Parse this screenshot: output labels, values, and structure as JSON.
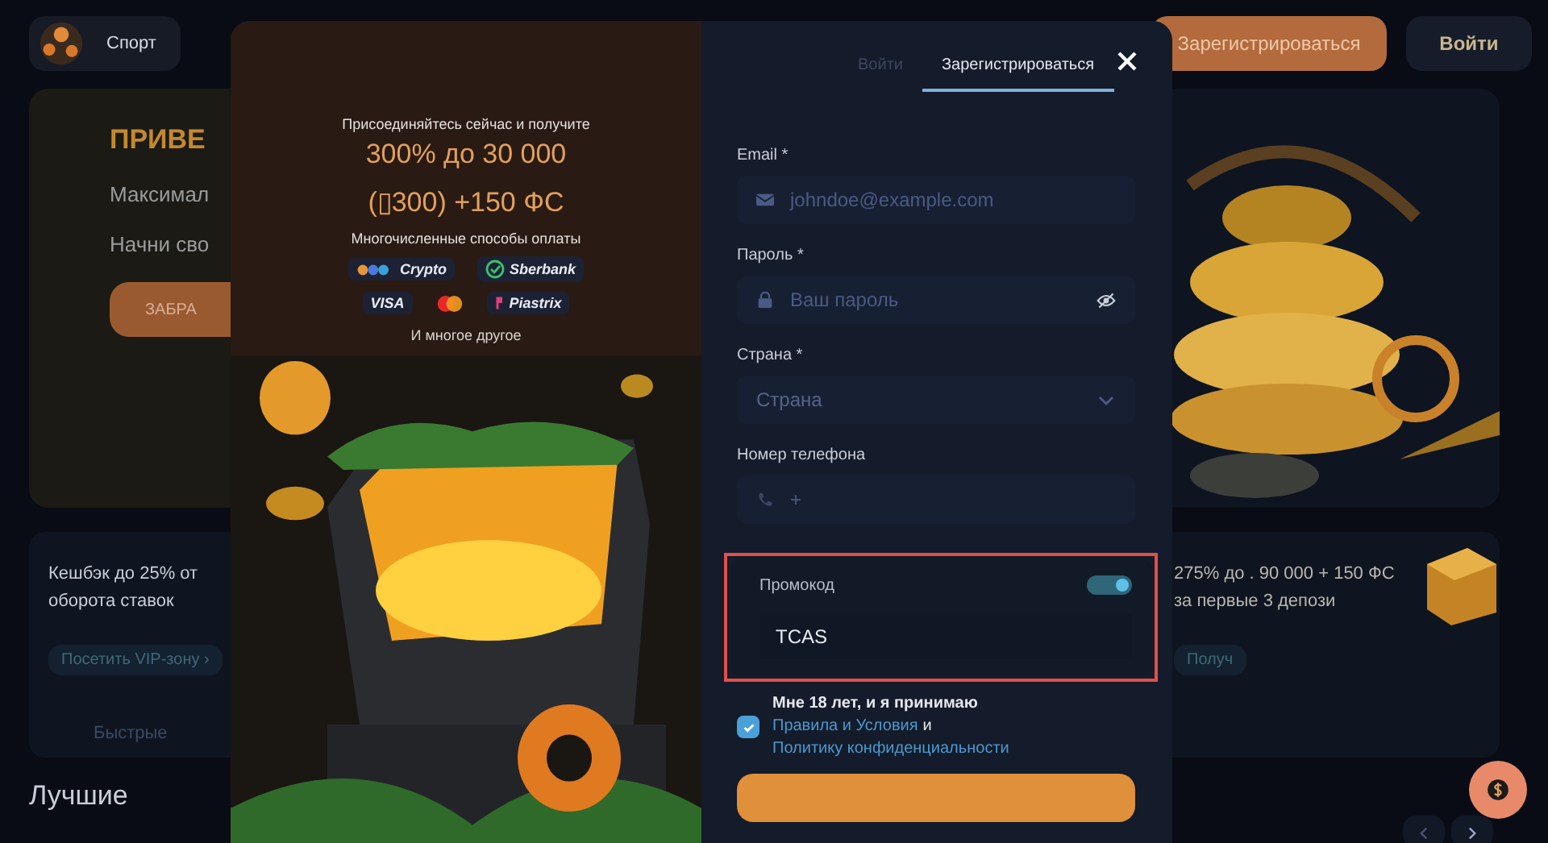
{
  "header": {
    "sport_label": "Спорт",
    "register_button": "Зарегистрироваться",
    "login_button": "Войти"
  },
  "hero": {
    "title": "ПРИВЕ",
    "line_1": "Максимал",
    "line_2": "Начни сво",
    "button": "ЗАБРА"
  },
  "cards": [
    {
      "text": "Кешбэк до 25% от оборота ставок",
      "link": "Посетить VIP-зону ›"
    },
    {
      "text": "275% до . 90 000 + 150 ФС за первые 3 депози",
      "link": "Получ"
    }
  ],
  "quick_row": "Быстрые",
  "section_title": "Лучшие",
  "modal": {
    "promo": {
      "intro": "Присоединяйтесь сейчас и получите",
      "bonus_line_1": "300% до 30 000",
      "bonus_line_2": "(▯300) +150 ФС",
      "payments_title": "Многочисленные способы оплаты",
      "payments": [
        {
          "kind": "crypto",
          "label": "Crypto"
        },
        {
          "kind": "sber",
          "label": "Sberbank"
        },
        {
          "kind": "visa",
          "label": "VISA"
        },
        {
          "kind": "mastercard"
        },
        {
          "kind": "piastrix",
          "label": "Piastrix"
        }
      ],
      "more": "И многое другое"
    },
    "tabs": [
      {
        "label": "Войти",
        "selected": false
      },
      {
        "label": "Зарегистрироваться",
        "selected": true
      }
    ],
    "fields": [
      {
        "kind": "email",
        "label": "Email *",
        "placeholder": "johndoe@example.com"
      },
      {
        "kind": "password",
        "label": "Пароль *",
        "placeholder": "Ваш пароль"
      },
      {
        "kind": "select",
        "label": "Страна *",
        "placeholder": "Страна"
      },
      {
        "kind": "phone",
        "label": "Номер телефона",
        "placeholder": "+"
      }
    ],
    "promo_code": {
      "label": "Промокод",
      "on": true,
      "value": "TCAS"
    },
    "consent": {
      "checked": true,
      "text": "Мне 18 лет, и я принимаю",
      "rules_link": "Правила и Условия",
      "joiner": "и",
      "privacy_link": "Политику конфиденциальности"
    }
  }
}
